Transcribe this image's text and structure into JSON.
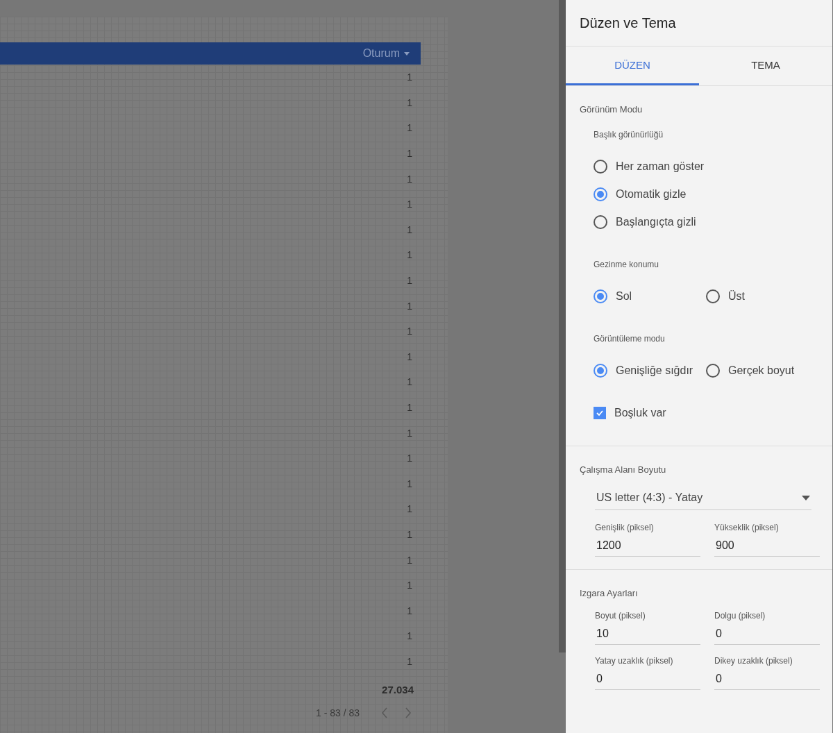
{
  "table": {
    "column": "Oturum",
    "rows": [
      "1",
      "1",
      "1",
      "1",
      "1",
      "1",
      "1",
      "1",
      "1",
      "1",
      "1",
      "1",
      "1",
      "1",
      "1",
      "1",
      "1",
      "1",
      "1",
      "1",
      "1",
      "1",
      "1",
      "1"
    ],
    "total": "27.034",
    "pagination": "1 - 83 / 83"
  },
  "panel": {
    "title": "Düzen ve Tema",
    "tabs": [
      {
        "label": "DÜZEN",
        "selected": true
      },
      {
        "label": "TEMA",
        "selected": false
      }
    ],
    "view_mode": {
      "title": "Görünüm Modu",
      "groups": [
        {
          "label": "Başlık görünürlüğü",
          "kind": "column",
          "options": [
            {
              "label": "Her zaman göster",
              "selected": false
            },
            {
              "label": "Otomatik gizle",
              "selected": true
            },
            {
              "label": "Başlangıçta gizli",
              "selected": false
            }
          ]
        },
        {
          "label": "Gezinme konumu",
          "kind": "row",
          "options": [
            {
              "label": "Sol",
              "selected": true
            },
            {
              "label": "Üst",
              "selected": false
            }
          ]
        },
        {
          "label": "Görüntüleme modu",
          "kind": "row",
          "options": [
            {
              "label": "Genişliğe sığdır",
              "selected": true
            },
            {
              "label": "Gerçek boyut",
              "selected": false
            }
          ]
        }
      ],
      "checkbox": {
        "label": "Boşluk var",
        "checked": true
      }
    },
    "canvas_size": {
      "title": "Çalışma Alanı Boyutu",
      "dropdown": "US letter (4:3) - Yatay",
      "fields": [
        {
          "label": "Genişlik (piksel)",
          "value": "1200"
        },
        {
          "label": "Yükseklik (piksel)",
          "value": "900"
        }
      ]
    },
    "grid": {
      "title": "Izgara Ayarları",
      "fields": [
        {
          "label": "Boyut (piksel)",
          "value": "10"
        },
        {
          "label": "Dolgu (piksel)",
          "value": "0"
        },
        {
          "label": "Yatay uzaklık (piksel)",
          "value": "0"
        },
        {
          "label": "Dikey uzaklık (piksel)",
          "value": "0"
        }
      ]
    }
  }
}
